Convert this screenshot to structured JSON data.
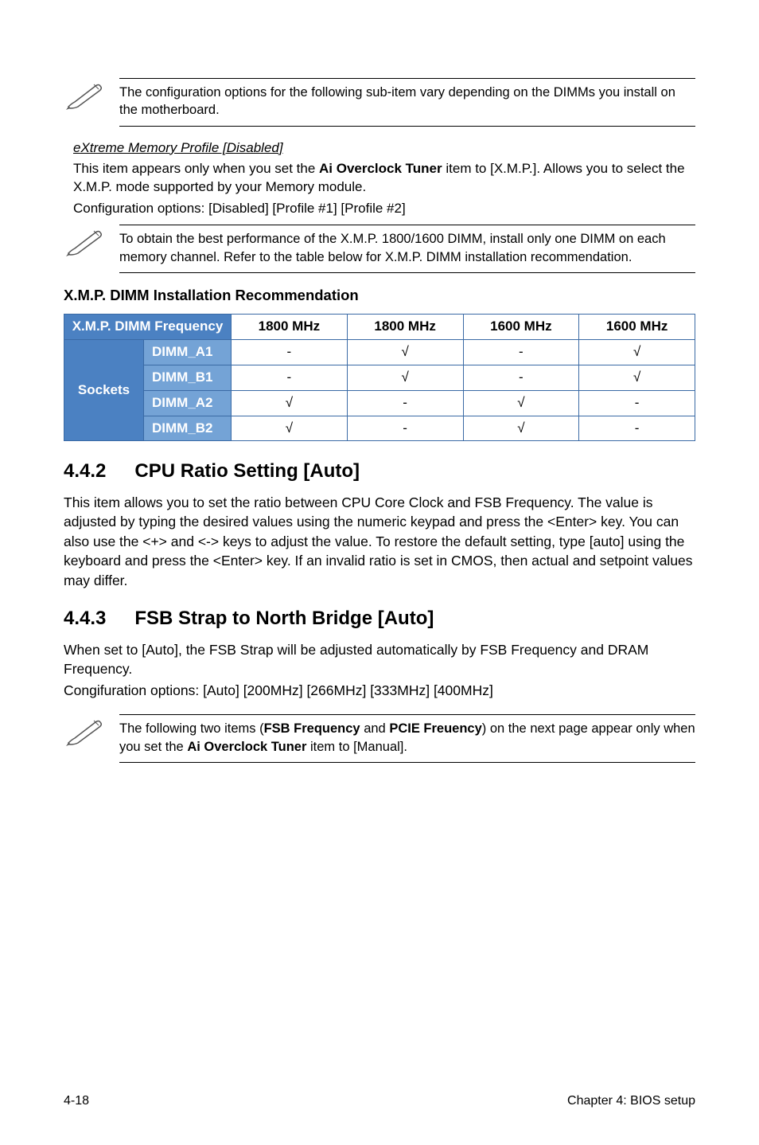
{
  "note1": "The configuration options for the following sub-item vary depending on the DIMMs you install on the motherboard.",
  "xmp_profile": {
    "title": "eXtreme Memory Profile [Disabled]",
    "line1a": "This item appears only when you set the ",
    "line1b": "Ai Overclock Tuner",
    "line1c": " item to [X.M.P.]. Allows you to select the X.M.P. mode supported by your Memory module.",
    "line2": "Configuration options: [Disabled] [Profile #1] [Profile #2]"
  },
  "note2": "To obtain the best performance of the X.M.P. 1800/1600 DIMM, install only one DIMM on each memory channel. Refer to the table below for X.M.P. DIMM installation recommendation.",
  "xmp_heading": "X.M.P. DIMM Installation Recommendation",
  "chart_data": {
    "type": "table",
    "header_left": "X.M.P. DIMM Frequency",
    "columns": [
      "1800 MHz",
      "1800 MHz",
      "1600 MHz",
      "1600 MHz"
    ],
    "row_group_label": "Sockets",
    "rows": [
      {
        "label": "DIMM_A1",
        "cells": [
          "-",
          "√",
          "-",
          "√"
        ]
      },
      {
        "label": "DIMM_B1",
        "cells": [
          "-",
          "√",
          "-",
          "√"
        ]
      },
      {
        "label": "DIMM_A2",
        "cells": [
          "√",
          "-",
          "√",
          "-"
        ]
      },
      {
        "label": "DIMM_B2",
        "cells": [
          "√",
          "-",
          "√",
          "-"
        ]
      }
    ]
  },
  "sec442": {
    "num": "4.4.2",
    "title": "CPU Ratio Setting [Auto]",
    "body": "This item allows you to set the ratio between CPU Core Clock and FSB Frequency. The value is adjusted by typing the desired values using the numeric keypad and press the <Enter> key. You can also use the <+> and <-> keys to adjust the value. To restore the default setting, type [auto] using the keyboard and press the <Enter> key. If an invalid ratio is set in CMOS, then actual and setpoint values may differ."
  },
  "sec443": {
    "num": "4.4.3",
    "title": "FSB Strap to North Bridge [Auto]",
    "body1": "When set to [Auto], the FSB Strap will be adjusted automatically by FSB Frequency and DRAM Frequency.",
    "body2": "Congifuration options: [Auto] [200MHz] [266MHz] [333MHz] [400MHz]"
  },
  "note3": {
    "a": "The following two items (",
    "b": "FSB Frequency",
    "c": " and ",
    "d": "PCIE Freuency",
    "e": ") on the next page appear only when you set the ",
    "f": "Ai Overclock Tuner",
    "g": " item to [Manual]."
  },
  "footer_left": "4-18",
  "footer_right": "Chapter 4: BIOS setup"
}
